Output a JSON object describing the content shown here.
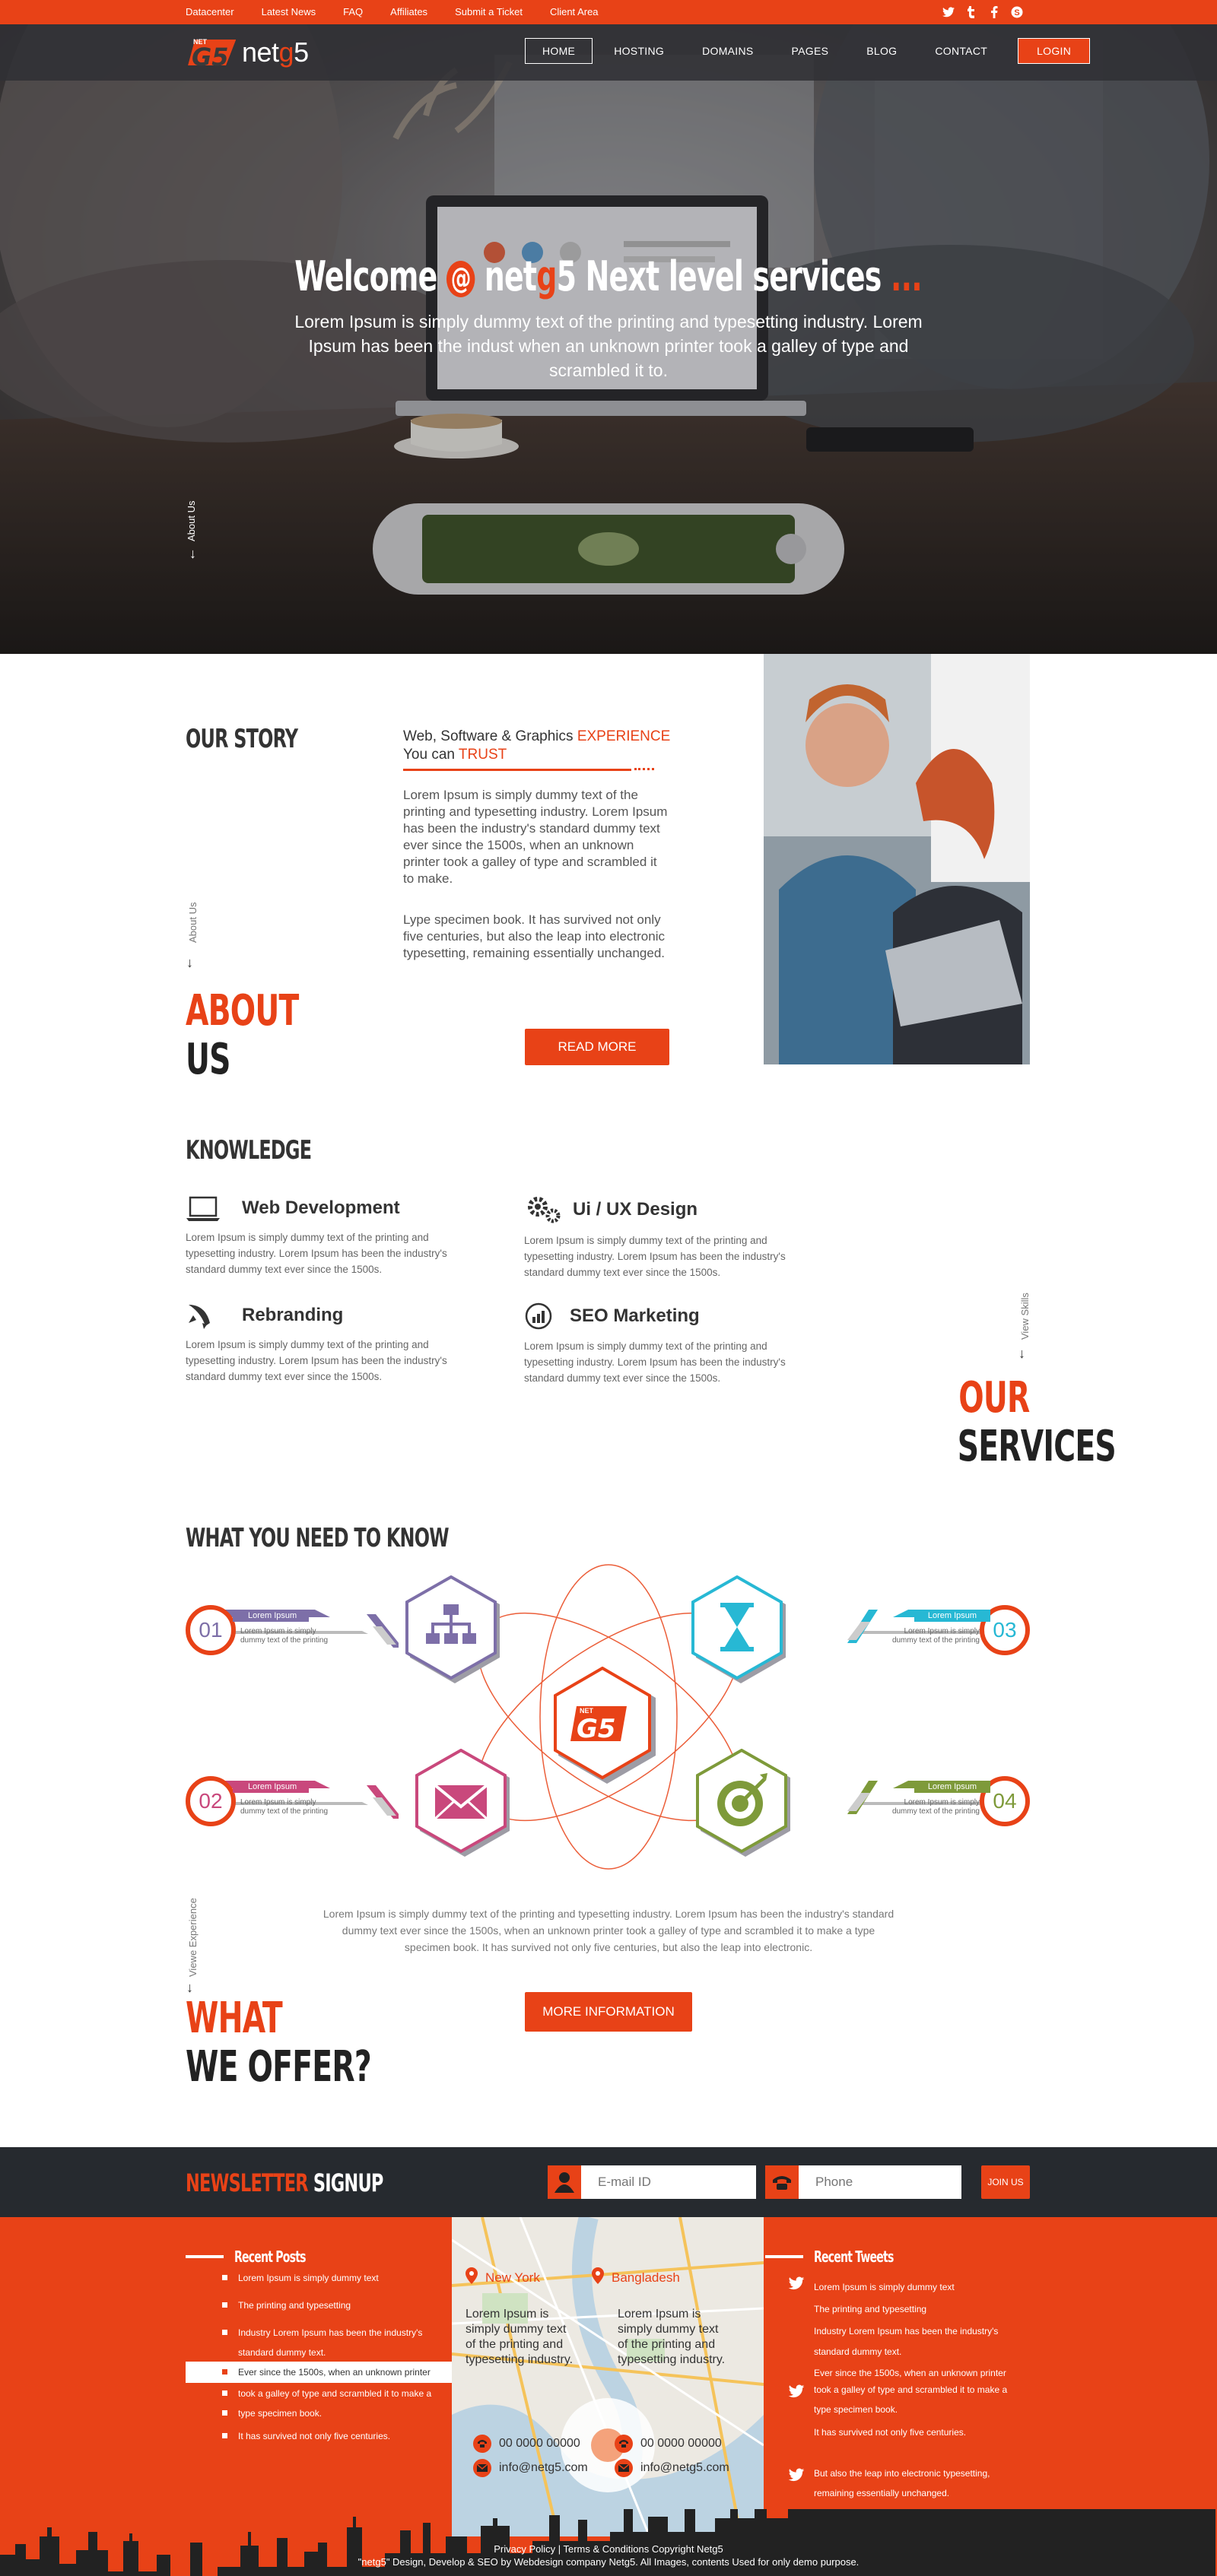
{
  "topbar": {
    "links": [
      "Datacenter",
      "Latest News",
      "FAQ",
      "Affiliates",
      "Submit a Ticket",
      "Client Area"
    ],
    "social": [
      {
        "icon": "twitter-icon",
        "glyph": "t"
      },
      {
        "icon": "tumblr-icon",
        "glyph": "t"
      },
      {
        "icon": "facebook-icon",
        "glyph": "f"
      },
      {
        "icon": "skype-icon",
        "glyph": "S"
      }
    ]
  },
  "brand": {
    "prefix": "net",
    "highlight": "g",
    "suffix": "5",
    "mark_top": "NET",
    "mark": "G5"
  },
  "nav": {
    "items": [
      "HOME",
      "HOSTING",
      "DOMAINS",
      "PAGES",
      "BLOG",
      "CONTACT"
    ],
    "login": "LOGIN"
  },
  "hero": {
    "title_a": "Welcome",
    "title_at": "@",
    "title_b": "net",
    "title_c": "g",
    "title_d": "5 Next level services",
    "title_dots": "...",
    "subtitle": "Lorem Ipsum is simply dummy text of the printing and typesetting industry. Lorem Ipsum has been the indust when an unknown printer took a galley of type and scrambled it to.",
    "side_label": "About Us"
  },
  "story": {
    "heading": "OUR STORY",
    "tag_a": "Web, Software & Graphics ",
    "tag_b": "EXPERIENCE",
    "tag_c": "You can ",
    "tag_d": "TRUST",
    "p1": "Lorem Ipsum is simply dummy text of the printing and typesetting industry. Lorem Ipsum has been the industry's standard dummy text ever since the 1500s, when an unknown printer took a galley of type and scrambled it to make.",
    "p2": "Lype specimen book. It has survived not only five centuries, but also the leap into electronic typesetting, remaining essentially unchanged.",
    "button": "READ MORE",
    "side_label": "About Us",
    "big_a": "ABOUT",
    "big_b": "US"
  },
  "knowledge": {
    "heading": "KNOWLEDGE",
    "items": [
      {
        "title": "Web Development",
        "icon": "laptop-icon",
        "text": "Lorem Ipsum is simply dummy text of the printing and typesetting industry. Lorem Ipsum has been the industry's standard dummy text ever since the 1500s."
      },
      {
        "title": "Ui / UX Design",
        "icon": "gears-icon",
        "text": "Lorem Ipsum is simply dummy text of the printing and typesetting industry. Lorem Ipsum has been the industry's standard dummy text ever since the 1500s."
      },
      {
        "title": "Rebranding",
        "icon": "rocket-icon",
        "text": "Lorem Ipsum is simply dummy text of the printing and typesetting industry. Lorem Ipsum has been the industry's standard dummy text ever since the 1500s."
      },
      {
        "title": "SEO Marketing",
        "icon": "seo-chart-icon",
        "text": "Lorem Ipsum is simply dummy text of the printing and typesetting industry. Lorem Ipsum has been the industry's standard dummy text ever since the 1500s."
      }
    ],
    "side_label": "View Skills",
    "big_a": "OUR",
    "big_b": "SERVICES"
  },
  "offer": {
    "heading": "WHAT YOU NEED TO KNOW",
    "badges": [
      {
        "num": "01",
        "label": "Lorem Ipsum",
        "desc": "Lorem Ipsum is simply dummy text of the printing",
        "color": "#7d6fa8"
      },
      {
        "num": "02",
        "label": "Lorem Ipsum",
        "desc": "Lorem Ipsum is simply dummy text of the printing",
        "color": "#c9487c"
      },
      {
        "num": "03",
        "label": "Lorem Ipsum",
        "desc": "Lorem Ipsum is simply dummy text of the printing",
        "color": "#27b8d4"
      },
      {
        "num": "04",
        "label": "Lorem Ipsum",
        "desc": "Lorem Ipsum is simply dummy text of the printing",
        "color": "#7e9a3a"
      }
    ],
    "hex_icons": [
      "sitemap-icon",
      "hourglass-icon",
      "envelope-icon",
      "target-icon"
    ],
    "text": "Lorem Ipsum is simply dummy text of the printing and typesetting industry. Lorem Ipsum has been the industry's standard dummy text ever since the 1500s, when an unknown printer took a galley of type and scrambled it to make a type specimen book. It has survived not only five centuries, but also the leap into electronic.",
    "button": "MORE INFORMATION",
    "side_label": "Viewe Experience",
    "big_a": "WHAT",
    "big_b": "WE OFFER?"
  },
  "newsletter": {
    "title_a": "NEWSLETTER",
    "title_b": " SIGNUP",
    "email_placeholder": "E-mail ID",
    "phone_placeholder": "Phone",
    "button": "JOIN US"
  },
  "footer": {
    "posts_heading": "Recent Posts",
    "posts": [
      "Lorem Ipsum is simply dummy text",
      "The printing and typesetting",
      "Industry Lorem Ipsum has been the industry's",
      "standard dummy text.",
      "Ever since the 1500s, when an unknown printer",
      "took a galley of type and scrambled it to make a",
      "type specimen book.",
      "It has survived not only five centuries."
    ],
    "map": {
      "ny": "New York",
      "bd": "Bangladesh",
      "ny_text": "Lorem Ipsum is simply dummy text of the printing and typesetting industry.",
      "bd_text": "Lorem Ipsum is simply dummy text of the printing and typesetting industry.",
      "ny_phone": "00 0000 00000",
      "ny_email": "info@netg5.com",
      "bd_phone": "00 0000 00000",
      "bd_email": "info@netg5.com"
    },
    "tweets_heading": "Recent Tweets",
    "tweets": [
      {
        "lines": [
          "Lorem Ipsum is simply dummy text",
          "The printing and typesetting",
          "Industry Lorem Ipsum has been the industry's",
          "standard dummy text.",
          "Ever since the 1500s, when an unknown printer"
        ]
      },
      {
        "lines": [
          "took a galley of type and scrambled it to make a",
          "type specimen book.",
          "It has survived not only five centuries."
        ]
      },
      {
        "lines": [
          "But also the leap into electronic typesetting,",
          "remaining essentially unchanged."
        ]
      }
    ],
    "copyright_a": "Privacy Policy | Terms & Conditions Copyright Netg5",
    "copyright_b": "\"netg5\" Design, Develop & SEO by Webdesign company Netg5. All Images, contents Used for only demo purpose."
  },
  "colors": {
    "accent": "#e84217",
    "dark": "#262a2f"
  }
}
